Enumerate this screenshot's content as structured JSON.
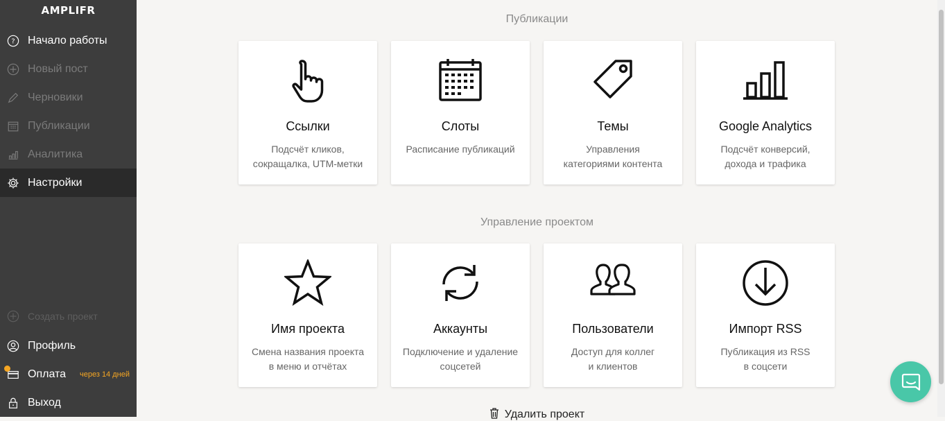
{
  "app": {
    "logo": "AMPLIFR"
  },
  "sidebar": {
    "items": [
      {
        "label": "Начало работы",
        "icon": "help-circle-icon"
      },
      {
        "label": "Новый пост",
        "icon": "plus-circle-icon"
      },
      {
        "label": "Черновики",
        "icon": "pencil-icon"
      },
      {
        "label": "Публикации",
        "icon": "calendar-icon"
      },
      {
        "label": "Аналитика",
        "icon": "bar-chart-icon"
      },
      {
        "label": "Настройки",
        "icon": "gear-icon",
        "active": true
      }
    ],
    "bottom": [
      {
        "label": "Создать проект",
        "icon": "plus-circle-icon"
      },
      {
        "label": "Профиль",
        "icon": "user-icon"
      },
      {
        "label": "Оплата",
        "icon": "credit-card-icon",
        "badge": "через 14 дней"
      },
      {
        "label": "Выход",
        "icon": "lock-icon"
      }
    ]
  },
  "sections": {
    "publications": {
      "title": "Публикации",
      "cards": [
        {
          "title": "Ссылки",
          "desc": "Подсчёт кликов,\nсокращалка, UTM-метки",
          "icon": "hand-pointer-icon"
        },
        {
          "title": "Слоты",
          "desc": "Расписание публикаций",
          "icon": "calendar-icon"
        },
        {
          "title": "Темы",
          "desc": "Управления\nкатегориями контента",
          "icon": "tag-icon"
        },
        {
          "title": "Google Analytics",
          "desc": "Подсчёт конверсий,\nдохода и трафика",
          "icon": "bar-chart-icon"
        }
      ]
    },
    "project": {
      "title": "Управление проектом",
      "cards": [
        {
          "title": "Имя проекта",
          "desc": "Смена названия проекта\nв меню и отчётах",
          "icon": "star-icon"
        },
        {
          "title": "Аккаунты",
          "desc": "Подключение и удаление\nсоцсетей",
          "icon": "refresh-icon"
        },
        {
          "title": "Пользователи",
          "desc": "Доступ для коллег\nи клиентов",
          "icon": "users-icon"
        },
        {
          "title": "Импорт RSS",
          "desc": "Публикация из RSS\nв соцсети",
          "icon": "download-circle-icon"
        }
      ]
    }
  },
  "delete_project": {
    "label": "Удалить проект",
    "icon": "trash-icon"
  },
  "colors": {
    "sidebar": "#3d3d3d",
    "active": "#2a2a2a",
    "badge": "#f5a623",
    "chat": "#49c7a8"
  }
}
